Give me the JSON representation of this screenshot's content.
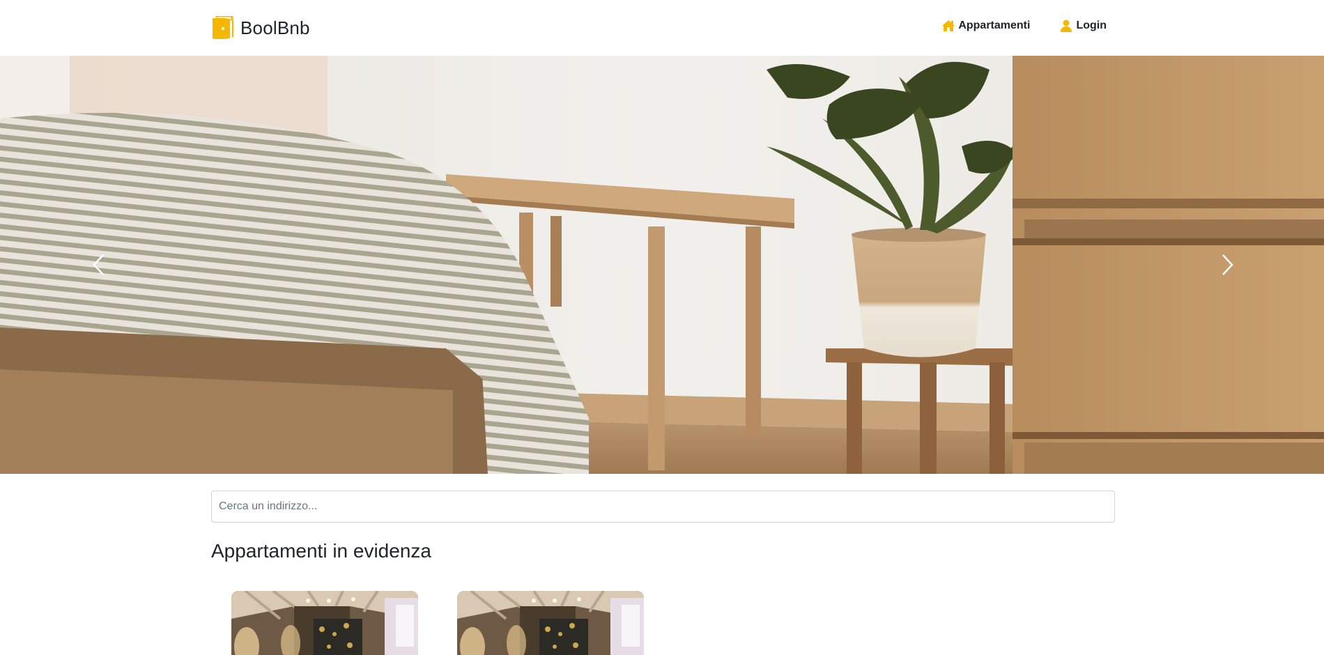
{
  "brand": {
    "name": "BoolBnb",
    "logo_icon": "door-icon",
    "accent": "#f5b800"
  },
  "nav": {
    "items": [
      {
        "label": "Appartamenti",
        "icon": "house-icon"
      },
      {
        "label": "Login",
        "icon": "user-icon"
      }
    ]
  },
  "carousel": {
    "prev_icon": "chevron-left-icon",
    "next_icon": "chevron-right-icon"
  },
  "search": {
    "placeholder": "Cerca un indirizzo...",
    "value": ""
  },
  "featured": {
    "title": "Appartamenti in evidenza",
    "cards": [
      {
        "image": "apartment-photo"
      },
      {
        "image": "apartment-photo"
      }
    ]
  }
}
